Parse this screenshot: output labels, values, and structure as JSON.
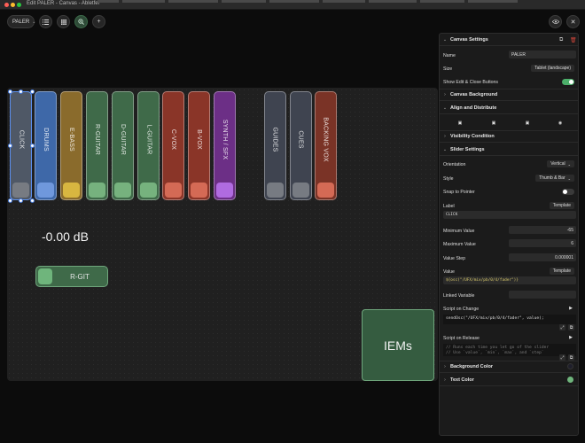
{
  "window": {
    "title": "Edit PALER - Canvas - Abletfel"
  },
  "toolbar": {
    "project": "PALER"
  },
  "canvas": {
    "sliders": [
      {
        "label": "CLICK",
        "body": "#4f5866",
        "thumb": "#777b82"
      },
      {
        "label": "DRUMS",
        "body": "#3e68a8",
        "thumb": "#6f98dc"
      },
      {
        "label": "E-BASS",
        "body": "#8a6b2c",
        "thumb": "#d8b640"
      },
      {
        "label": "R-GUITAR",
        "body": "#3f6a49",
        "thumb": "#76b27e"
      },
      {
        "label": "D-GUITAR",
        "body": "#3f6a49",
        "thumb": "#76b27e"
      },
      {
        "label": "L-GUITAR",
        "body": "#3f6a49",
        "thumb": "#76b27e"
      },
      {
        "label": "C-VOX",
        "body": "#8a3528",
        "thumb": "#d46a55"
      },
      {
        "label": "B-VOX",
        "body": "#8a3528",
        "thumb": "#d46a55"
      },
      {
        "label": "SYNTH / SFX",
        "body": "#6c2f86",
        "thumb": "#b06be0"
      },
      {
        "label": "GUIDES",
        "body": "#3f4450",
        "thumb": "#777b82"
      },
      {
        "label": "CUES",
        "body": "#3f4450",
        "thumb": "#777b82"
      },
      {
        "label": "BACKING VOX",
        "body": "#7a3326",
        "thumb": "#d46a55"
      }
    ],
    "db_readout": "-0.00 dB",
    "rgit_label": "R-GIT",
    "iems_label": "IEMs"
  },
  "inspector": {
    "canvas_settings": {
      "header": "Canvas Settings",
      "name_label": "Name",
      "name_value": "PALER",
      "size_label": "Size",
      "size_value": "Tablet (landscape)",
      "edit_close_label": "Show Edit & Close Buttons"
    },
    "canvas_background": "Canvas Background",
    "align_distribute": "Align and Distribute",
    "visibility": "Visibility Condition",
    "slider_settings": {
      "header": "Slider Settings",
      "orientation_label": "Orientation",
      "orientation_value": "Vertical",
      "style_label": "Style",
      "style_value": "Thumb & Bar",
      "snap_label": "Snap to Pointer",
      "label_label": "Label",
      "label_mode": "Template",
      "label_value": "CLICK",
      "min_label": "Minimum Value",
      "min_value": "-65",
      "max_label": "Maximum Value",
      "max_value": "6",
      "step_label": "Value Step",
      "step_value": "0.000001",
      "value_label": "Value",
      "value_mode": "Template",
      "value_expr": "${osc(\"/UFX/mix/pb/0/4/fader\")}",
      "linked_label": "Linked Variable",
      "script_change_label": "Script on Change",
      "script_change_code": "sendOsc(\"/UFX/mix/pb/0/4/fader\", value);",
      "script_release_label": "Script on Release",
      "script_release_code": "// Runs each time you let go of the slider\n// Use `value`, `min`, `max`, and `step`"
    },
    "background_color": "Background Color",
    "text_color": "Text Color"
  },
  "colors": {
    "accent_green": "#6fa67c",
    "selection_blue": "#5b8ff0",
    "toggle_on": "#4caf6a",
    "text_color_swatch": "#6fb57c"
  }
}
